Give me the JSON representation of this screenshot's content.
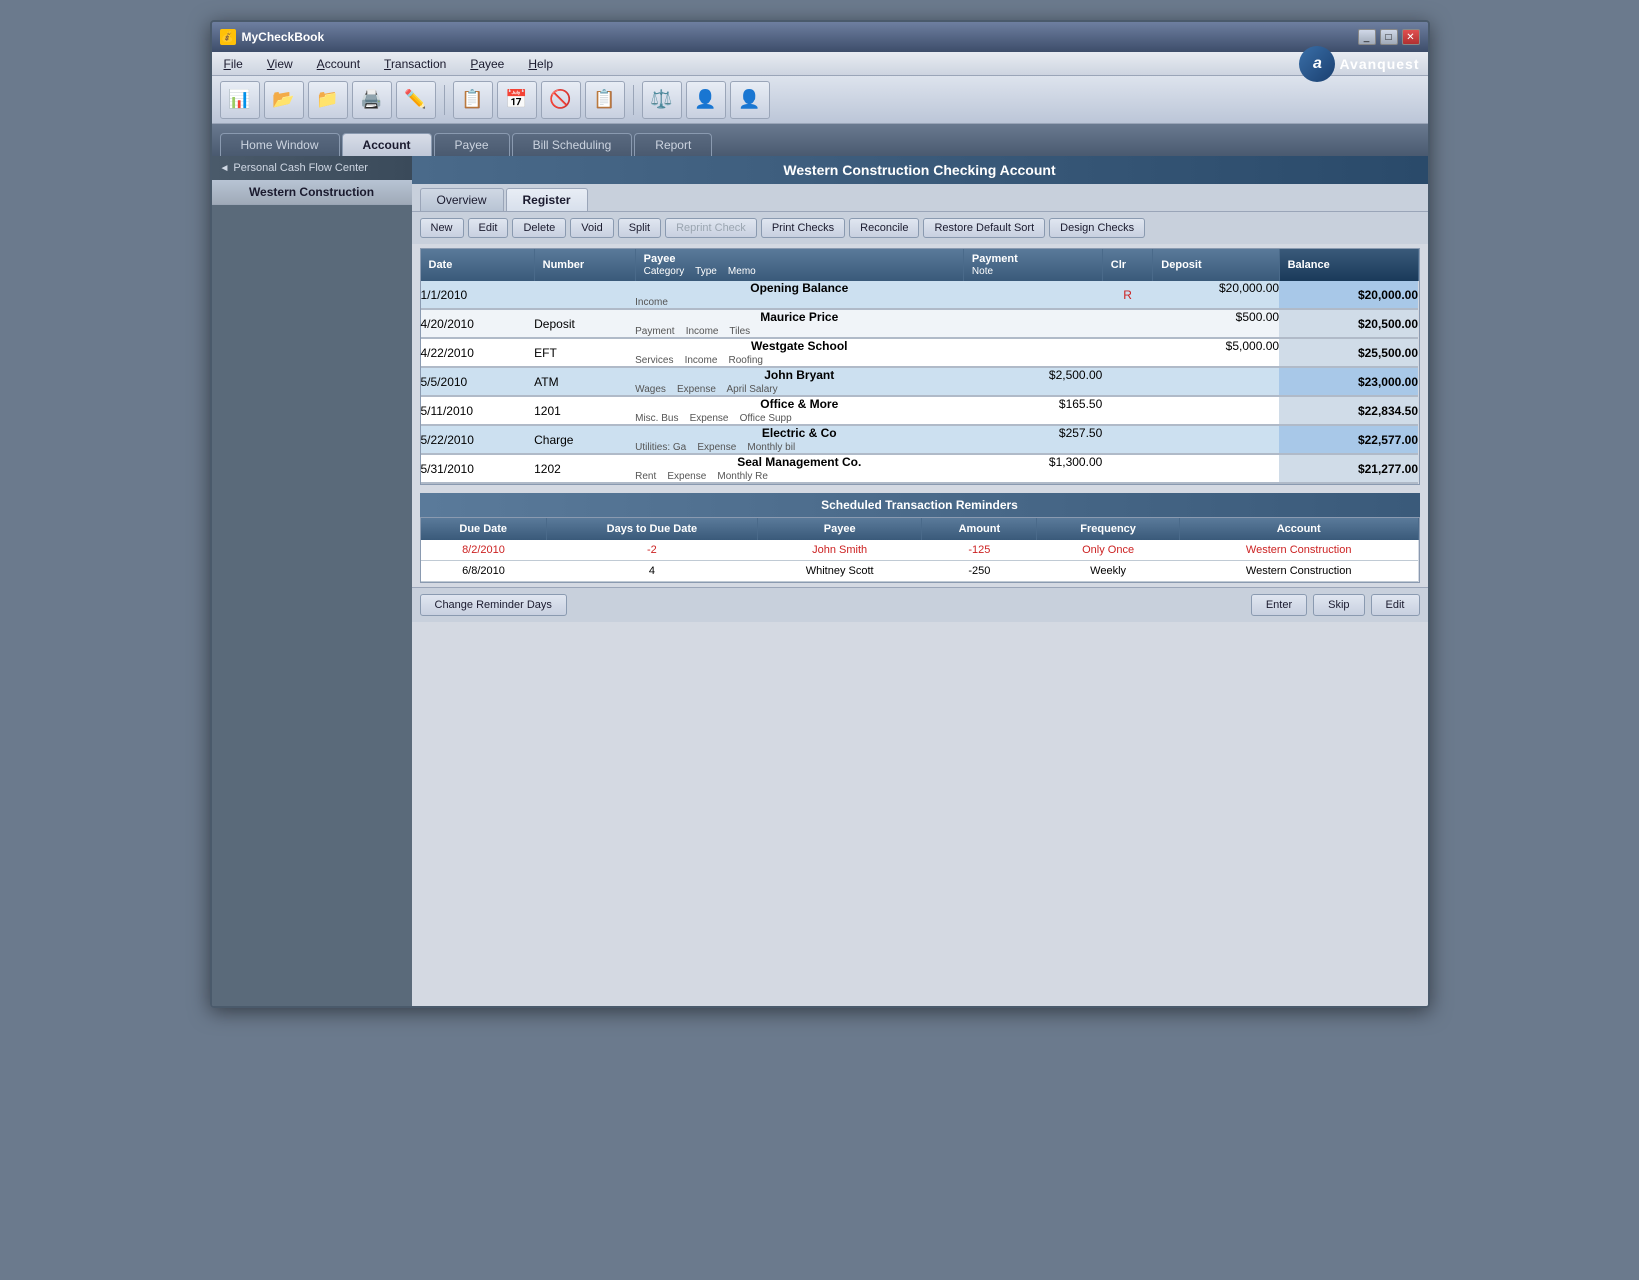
{
  "window": {
    "title": "MyCheckBook",
    "icon": "💰"
  },
  "menu": {
    "items": [
      "File",
      "View",
      "Account",
      "Transaction",
      "Payee",
      "Help"
    ]
  },
  "toolbar": {
    "buttons": [
      "📊",
      "📂",
      "📁",
      "🖨️",
      "✏️",
      "📋",
      "📅",
      "🚫",
      "📋",
      "⚖️",
      "👤",
      "👤"
    ]
  },
  "nav_tabs": {
    "tabs": [
      "Home Window",
      "Account",
      "Payee",
      "Bill Scheduling",
      "Report"
    ],
    "active": "Account"
  },
  "sidebar": {
    "header": "Personal Cash Flow Center",
    "items": [
      "Western Construction"
    ]
  },
  "account_title": "Western Construction  Checking Account",
  "register_tabs": [
    "Overview",
    "Register"
  ],
  "action_buttons": [
    "New",
    "Edit",
    "Delete",
    "Void",
    "Split",
    "Reprint Check",
    "Print Checks",
    "Reconcile",
    "Restore Default Sort",
    "Design Checks"
  ],
  "table_headers": {
    "main": [
      "Date",
      "Number",
      "Payee",
      "Payment",
      "Clr",
      "Deposit",
      "Balance"
    ],
    "sub": [
      "",
      "",
      "Category    Type    Memo",
      "Note",
      "",
      "",
      ""
    ]
  },
  "transactions": [
    {
      "date": "1/1/2010",
      "number": "",
      "payee": "Opening Balance",
      "category": "Income",
      "type": "",
      "memo": "",
      "payment": "",
      "clr": "R",
      "deposit": "$20,000.00",
      "balance": "$20,000.00",
      "highlight": true
    },
    {
      "date": "4/20/2010",
      "number": "Deposit",
      "payee": "Maurice Price",
      "category": "Payment",
      "type": "Income",
      "memo": "Tiles",
      "payment": "",
      "clr": "",
      "deposit": "$500.00",
      "balance": "$20,500.00",
      "highlight": false
    },
    {
      "date": "4/22/2010",
      "number": "EFT",
      "payee": "Westgate School",
      "category": "Services",
      "type": "Income",
      "memo": "Roofing",
      "payment": "",
      "clr": "",
      "deposit": "$5,000.00",
      "balance": "$25,500.00",
      "highlight": false
    },
    {
      "date": "5/5/2010",
      "number": "ATM",
      "payee": "John Bryant",
      "category": "Wages",
      "type": "Expense",
      "memo": "April Salary",
      "payment": "$2,500.00",
      "clr": "",
      "deposit": "",
      "balance": "$23,000.00",
      "highlight": true
    },
    {
      "date": "5/11/2010",
      "number": "1201",
      "payee": "Office & More",
      "category": "Misc. Bus",
      "type": "Expense",
      "memo": "Office Supp",
      "payment": "$165.50",
      "clr": "",
      "deposit": "",
      "balance": "$22,834.50",
      "highlight": false
    },
    {
      "date": "5/22/2010",
      "number": "Charge",
      "payee": "Electric & Co",
      "category": "Utilities: Ga",
      "type": "Expense",
      "memo": "Monthly bil",
      "payment": "$257.50",
      "clr": "",
      "deposit": "",
      "balance": "$22,577.00",
      "highlight": true
    },
    {
      "date": "5/31/2010",
      "number": "1202",
      "payee": "Seal Management Co.",
      "category": "Rent",
      "type": "Expense",
      "memo": "Monthly Re",
      "payment": "$1,300.00",
      "clr": "",
      "deposit": "",
      "balance": "$21,277.00",
      "highlight": false
    }
  ],
  "reminders": {
    "title": "Scheduled Transaction Reminders",
    "headers": [
      "Due Date",
      "Days to Due Date",
      "Payee",
      "Amount",
      "Frequency",
      "Account"
    ],
    "rows": [
      {
        "due_date": "8/2/2010",
        "days": "-2",
        "payee": "John Smith",
        "amount": "-125",
        "frequency": "Only Once",
        "account": "Western Construction",
        "overdue": true
      },
      {
        "due_date": "6/8/2010",
        "days": "4",
        "payee": "Whitney Scott",
        "amount": "-250",
        "frequency": "Weekly",
        "account": "Western Construction",
        "overdue": false
      }
    ]
  },
  "bottom_buttons": [
    "Change Reminder Days",
    "Enter",
    "Skip",
    "Edit"
  ]
}
